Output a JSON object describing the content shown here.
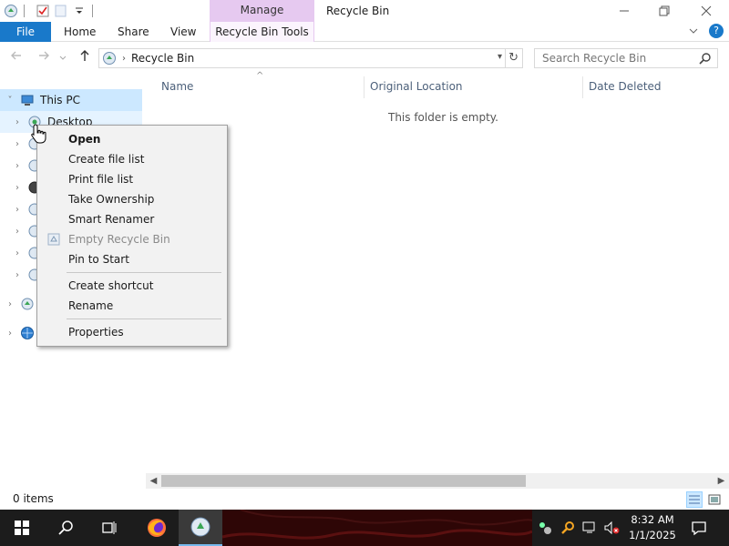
{
  "window": {
    "title": "Recycle Bin",
    "contextual_tab_group": "Manage",
    "controls": [
      "minimize",
      "maximize",
      "close"
    ]
  },
  "ribbon": {
    "file_label": "File",
    "tabs": [
      "Home",
      "Share",
      "View"
    ],
    "contextual_tab": "Recycle Bin Tools",
    "help_label": "?"
  },
  "address": {
    "path": [
      "Recycle Bin"
    ]
  },
  "search": {
    "placeholder": "Search Recycle Bin"
  },
  "tree": {
    "this_pc": "This PC",
    "desktop": "Desktop"
  },
  "columns": [
    "Name",
    "Original Location",
    "Date Deleted"
  ],
  "content": {
    "empty_message": "This folder is empty."
  },
  "status": {
    "item_count": "0 items"
  },
  "context_menu": {
    "items": [
      {
        "label": "Open",
        "bold": true
      },
      {
        "label": "Create file list"
      },
      {
        "label": "Print file list"
      },
      {
        "label": "Take Ownership"
      },
      {
        "label": "Smart Renamer"
      },
      {
        "label": "Empty Recycle Bin",
        "disabled": true,
        "icon": "recycle-bin-icon"
      },
      {
        "label": "Pin to Start"
      },
      {
        "label": "Create shortcut"
      },
      {
        "label": "Rename"
      },
      {
        "label": "Properties"
      }
    ]
  },
  "taskbar": {
    "time": "8:32 AM",
    "date": "1/1/2025",
    "apps": [
      "start",
      "search",
      "task-view",
      "firefox",
      "recycle-bin"
    ]
  },
  "colors": {
    "file_tab": "#1979ca",
    "manage_tab": "#e6c9f0",
    "selection": "#cce8ff",
    "taskbar": "#1c1c1c"
  }
}
